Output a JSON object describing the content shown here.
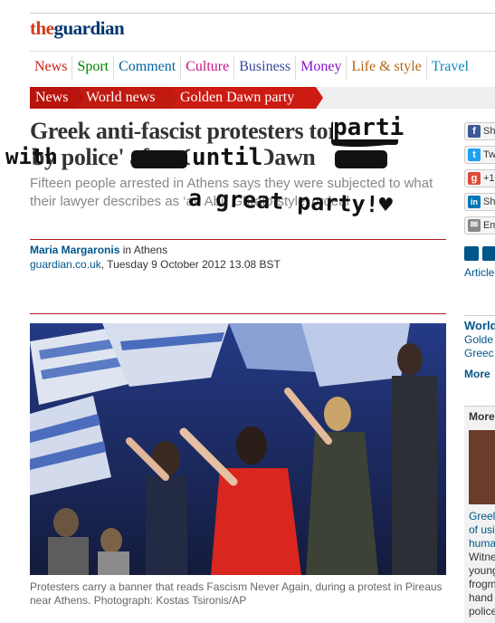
{
  "logo": {
    "the": "the",
    "guardian": "guardian"
  },
  "nav": [
    {
      "label": "News",
      "color": "#cd1f0f"
    },
    {
      "label": "Sport",
      "color": "#008000"
    },
    {
      "label": "Comment",
      "color": "#0064a6"
    },
    {
      "label": "Culture",
      "color": "#c7128b"
    },
    {
      "label": "Business",
      "color": "#3649a0"
    },
    {
      "label": "Money",
      "color": "#8a12c7"
    },
    {
      "label": "Life & style",
      "color": "#b56413"
    },
    {
      "label": "Travel",
      "color": "#0a87bd"
    }
  ],
  "breadcrumb": [
    "News",
    "World news",
    "Golden Dawn party"
  ],
  "article": {
    "headline_line1": "Greek anti-fascist protesters tortured",
    "headline_line2": "by police' after Golden Dawn",
    "standfirst": "Fifteen people arrested in Athens says they were subjected to what their lawyer describes as ‘an Abu Ghraib-style’ ordeal",
    "author": "Maria Margaronis",
    "location": " in Athens",
    "site": "guardian.co.uk",
    "dateline": ", Tuesday 9 October 2012 13.08 BST",
    "caption": "Protesters carry a banner that reads Fascism Never Again, during a protest in Pireaus near Athens. Photograph: Kostas Tsironis/AP"
  },
  "graffiti": {
    "parti": "parti",
    "with": "with",
    "until": "until",
    "a_great_party": "a great party!♥"
  },
  "sidebar": {
    "share_buttons": [
      {
        "label": "Sh",
        "icon": "facebook-icon",
        "glyph": "f",
        "color": "#3b5998"
      },
      {
        "label": "Tw",
        "icon": "twitter-icon",
        "glyph": "t",
        "color": "#1da1f2"
      },
      {
        "label": "+1",
        "icon": "google-plus-icon",
        "glyph": "g",
        "color": "#dd4b39"
      },
      {
        "label": "Sh",
        "icon": "linkedin-icon",
        "glyph": "in",
        "color": "#0077b5"
      },
      {
        "label": "Em",
        "icon": "email-icon",
        "glyph": "✉",
        "color": "#888888"
      }
    ],
    "article_label": "Article",
    "world_heading": "World",
    "world_links": [
      "Golde",
      "Greec"
    ],
    "more_link": "More",
    "more_box_title": "More",
    "teaser_title": [
      "Greel",
      "of usi",
      "huma"
    ],
    "teaser_text": [
      "Witne",
      "young",
      "frogm",
      "hand",
      "police"
    ]
  }
}
